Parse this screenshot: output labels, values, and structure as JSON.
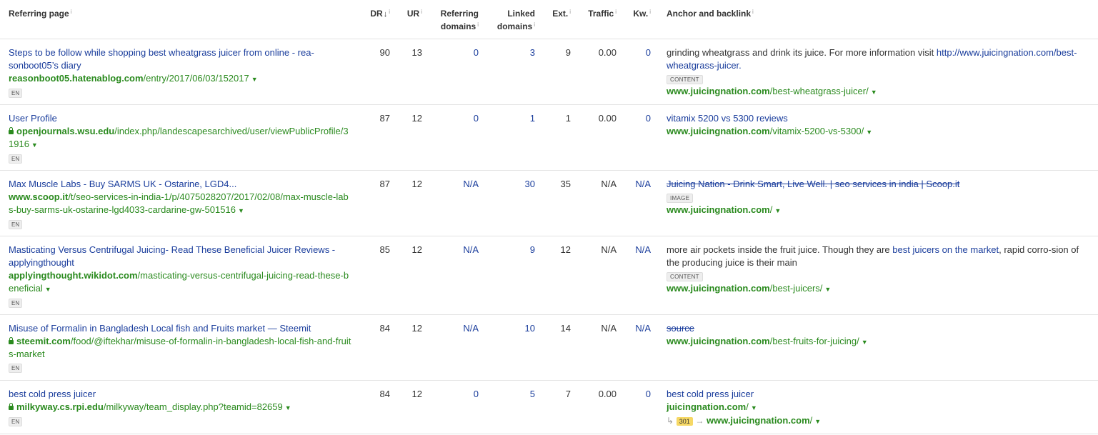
{
  "headers": {
    "referring_page": "Referring page",
    "dr": "DR",
    "dr_sort": "↓",
    "ur": "UR",
    "referring_domains_1": "Referring",
    "referring_domains_2": "domains",
    "linked_domains_1": "Linked",
    "linked_domains_2": "domains",
    "ext": "Ext.",
    "traffic": "Traffic",
    "kw": "Kw.",
    "anchor": "Anchor and backlink",
    "info": "i"
  },
  "rows": [
    {
      "title": "Steps to be follow while shopping best wheatgrass juicer from online - rea-sonboot05’s diary",
      "url_host": "reasonboot05.hatenablog.com",
      "url_path": "/entry/2017/06/03/152017",
      "secure": false,
      "lang": "EN",
      "dr": "90",
      "ur": "13",
      "ref_domains": "0",
      "linked_domains": "3",
      "ext": "9",
      "traffic": "0.00",
      "kw": "0",
      "anchor_before": "grinding wheatgrass and drink its juice. For more information visit ",
      "anchor_link": "http://www.juicingnation.com/best-wheatgrass-juicer.",
      "anchor_after": "",
      "anchor_tag": "CONTENT",
      "backlink_host": "www.juicingnation.com",
      "backlink_path": "/best-wheatgrass-juicer/"
    },
    {
      "title": "User Profile",
      "url_host": "openjournals.wsu.edu",
      "url_path": "/index.php/landescapesarchived/user/viewPublicProfile/31916",
      "secure": true,
      "lang": "EN",
      "dr": "87",
      "ur": "12",
      "ref_domains": "0",
      "linked_domains": "1",
      "ext": "1",
      "traffic": "0.00",
      "kw": "0",
      "anchor_link_text": "vitamix 5200 vs 5300 reviews",
      "backlink_host": "www.juicingnation.com",
      "backlink_path": "/vitamix-5200-vs-5300/"
    },
    {
      "title": "Max Muscle Labs - Buy SARMS UK - Ostarine, LGD4...",
      "url_host": "www.scoop.it",
      "url_path": "/t/seo-services-in-india-1/p/4075028207/2017/02/08/max-muscle-labs-buy-sarms-uk-ostarine-lgd4033-cardarine-gw-501516",
      "secure": false,
      "lang": "EN",
      "dr": "87",
      "ur": "12",
      "ref_domains": "N/A",
      "linked_domains": "30",
      "ext": "35",
      "traffic": "N/A",
      "kw": "N/A",
      "anchor_strike": "Juicing Nation - Drink Smart, Live Well. | seo services in india | Scoop.it",
      "anchor_tag": "IMAGE",
      "backlink_host": "www.juicingnation.com",
      "backlink_path": "/"
    },
    {
      "title": "Masticating Versus Centrifugal Juicing- Read These Beneficial Juicer Reviews - applyingthought",
      "url_host": "applyingthought.wikidot.com",
      "url_path": "/masticating-versus-centrifugal-juicing-read-these-beneficial",
      "secure": false,
      "lang": "EN",
      "dr": "85",
      "ur": "12",
      "ref_domains": "N/A",
      "linked_domains": "9",
      "ext": "12",
      "traffic": "N/A",
      "kw": "N/A",
      "anchor_before": "more air pockets inside the fruit juice. Though they are ",
      "anchor_link": "best juicers on the market",
      "anchor_after": ", rapid corro-sion of the producing juice is their main",
      "anchor_tag": "CONTENT",
      "backlink_host": "www.juicingnation.com",
      "backlink_path": "/best-juicers/"
    },
    {
      "title": "Misuse of Formalin in Bangladesh Local fish and Fruits market — Steemit",
      "url_host": "steemit.com",
      "url_path": "/food/@iftekhar/misuse-of-formalin-in-bangladesh-local-fish-and-fruits-market",
      "secure": true,
      "lang": "EN",
      "dr": "84",
      "ur": "12",
      "ref_domains": "N/A",
      "linked_domains": "10",
      "ext": "14",
      "traffic": "N/A",
      "kw": "N/A",
      "anchor_strike": "source",
      "backlink_host": "www.juicingnation.com",
      "backlink_path": "/best-fruits-for-juicing/"
    },
    {
      "title": "best cold press juicer",
      "url_host": "milkyway.cs.rpi.edu",
      "url_path": "/milkyway/team_display.php?teamid=82659",
      "secure": true,
      "lang": "EN",
      "dr": "84",
      "ur": "12",
      "ref_domains": "0",
      "linked_domains": "5",
      "ext": "7",
      "traffic": "0.00",
      "kw": "0",
      "anchor_link_text": "best cold press juicer",
      "backlink_host": "juicingnation.com",
      "backlink_path": "/",
      "redirect_code": "301",
      "redirect_arrow": "↳",
      "redirect_sep": "→",
      "redirect_host": "www.juicingnation.com",
      "redirect_path": "/"
    }
  ]
}
